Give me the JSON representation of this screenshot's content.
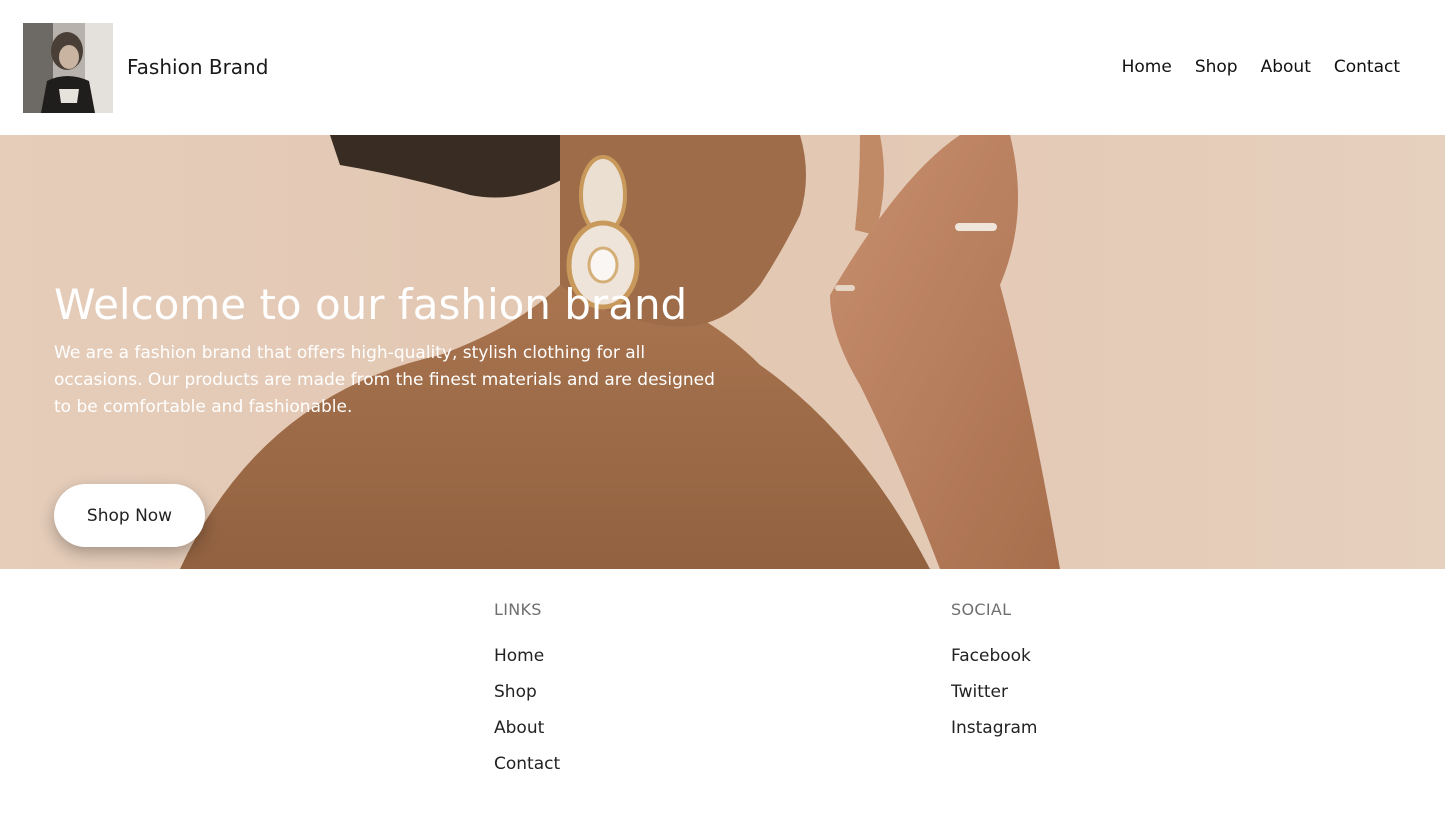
{
  "header": {
    "brand": "Fashion Brand",
    "nav": [
      "Home",
      "Shop",
      "About",
      "Contact"
    ]
  },
  "hero": {
    "title": "Welcome to our fashion brand",
    "text": "We are a fashion brand that offers high-quality, stylish clothing for all occasions. Our products are made from the finest materials and are designed to be comfortable and fashionable.",
    "button": "Shop Now"
  },
  "footer": {
    "links_heading": "LINKS",
    "links": [
      "Home",
      "Shop",
      "About",
      "Contact"
    ],
    "social_heading": "SOCIAL",
    "social": [
      "Facebook",
      "Twitter",
      "Instagram"
    ]
  },
  "colors": {
    "hero_bg": "#c89a76",
    "text_dark": "#1f1f1f",
    "muted": "#6f6f6f",
    "white": "#ffffff"
  }
}
